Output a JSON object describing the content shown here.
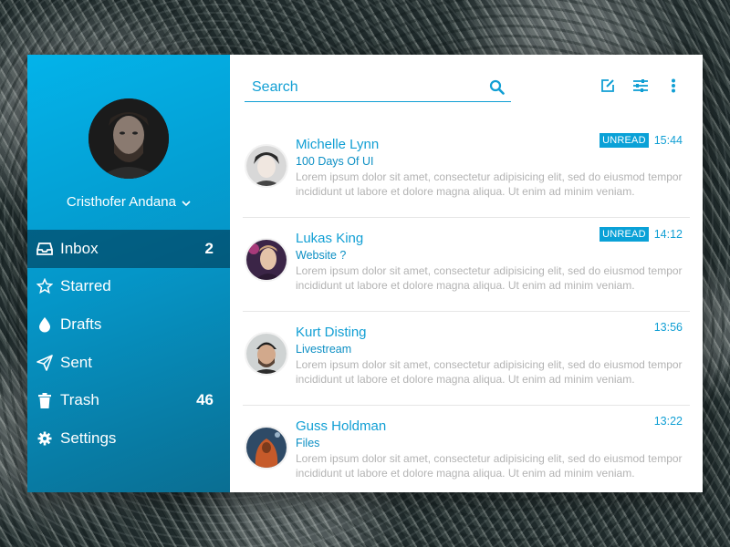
{
  "colors": {
    "accent": "#03b3ea",
    "accent_dark": "#0a6e92",
    "link": "#119fd4",
    "muted": "#b3b3b3"
  },
  "profile": {
    "name": "Cristhofer Andana",
    "avatar_icon": "user-avatar"
  },
  "nav": [
    {
      "label": "Inbox",
      "icon": "inbox-icon",
      "count": "2",
      "active": true
    },
    {
      "label": "Starred",
      "icon": "star-icon",
      "count": ""
    },
    {
      "label": "Drafts",
      "icon": "drop-icon",
      "count": ""
    },
    {
      "label": "Sent",
      "icon": "send-icon",
      "count": ""
    },
    {
      "label": "Trash",
      "icon": "trash-icon",
      "count": "46"
    },
    {
      "label": "Settings",
      "icon": "gear-icon",
      "count": ""
    }
  ],
  "search": {
    "placeholder": "Search",
    "value": ""
  },
  "toolbar": {
    "icons": [
      "compose-icon",
      "filter-icon",
      "more-icon"
    ]
  },
  "messages": [
    {
      "name": "Michelle Lynn",
      "subject": "100 Days Of UI",
      "preview": "Lorem ipsum dolor sit amet, consectetur adipisicing elit, sed do eiusmod tempor incididunt ut labore et dolore magna aliqua. Ut enim ad minim veniam.",
      "badge": "UNREAD",
      "time": "15:44"
    },
    {
      "name": "Lukas King",
      "subject": "Website ?",
      "preview": "Lorem ipsum dolor sit amet, consectetur adipisicing elit, sed do eiusmod tempor incididunt ut labore et dolore magna aliqua. Ut enim ad minim veniam.",
      "badge": "UNREAD",
      "time": "14:12"
    },
    {
      "name": "Kurt Disting",
      "subject": "Livestream",
      "preview": "Lorem ipsum dolor sit amet, consectetur adipisicing elit, sed do eiusmod tempor incididunt ut labore et dolore magna aliqua. Ut enim ad minim veniam.",
      "badge": "",
      "time": "13:56"
    },
    {
      "name": "Guss Holdman",
      "subject": "Files",
      "preview": "Lorem ipsum dolor sit amet, consectetur adipisicing elit, sed do eiusmod tempor incididunt ut labore et dolore magna aliqua. Ut enim ad minim veniam.",
      "badge": "",
      "time": "13:22"
    }
  ]
}
